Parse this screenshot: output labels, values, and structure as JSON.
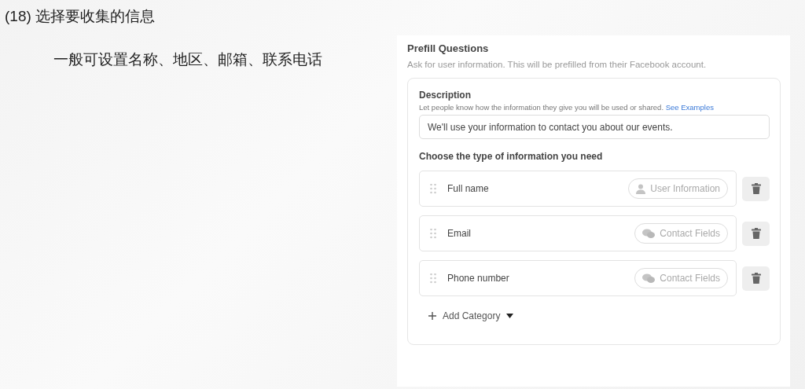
{
  "slide": {
    "step": "(18) 选择要收集的信息",
    "note": "一般可设置名称、地区、邮箱、联系电话"
  },
  "prefill": {
    "title": "Prefill Questions",
    "subtitle": "Ask for user information. This will be prefilled from their Facebook account.",
    "description": {
      "label": "Description",
      "help": "Let people know how the information they give you will be used or shared.",
      "link": "See Examples",
      "value": "We'll use your information to contact you about our events."
    },
    "choose_label": "Choose the type of information you need",
    "categories": [
      {
        "name": "Full name",
        "tag": "User Information",
        "kind": "user"
      },
      {
        "name": "Email",
        "tag": "Contact Fields",
        "kind": "contact"
      },
      {
        "name": "Phone number",
        "tag": "Contact Fields",
        "kind": "contact"
      }
    ],
    "add_button": "Add Category"
  }
}
